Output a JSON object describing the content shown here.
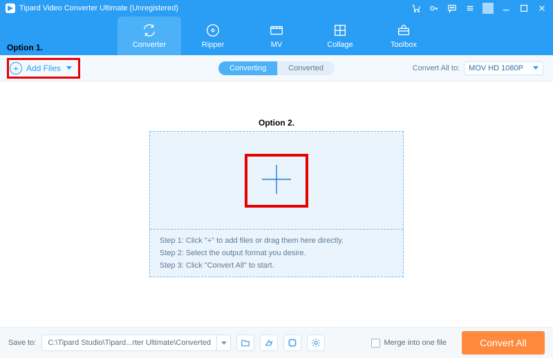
{
  "title": "Tipard Video Converter Ultimate (Unregistered)",
  "tabs": {
    "converter": "Converter",
    "ripper": "Ripper",
    "mv": "MV",
    "collage": "Collage",
    "toolbox": "Toolbox"
  },
  "subbar": {
    "add_files": "Add Files",
    "seg_converting": "Converting",
    "seg_converted": "Converted",
    "convert_all_to": "Convert All to:",
    "format_selected": "MOV HD 1080P"
  },
  "annotations": {
    "option1": "Option 1.",
    "option2": "Option 2."
  },
  "steps": {
    "s1": "Step 1: Click \"+\" to add files or drag them here directly.",
    "s2": "Step 2: Select the output format you desire.",
    "s3": "Step 3: Click \"Convert All\" to start."
  },
  "bottom": {
    "save_to": "Save to:",
    "path": "C:\\Tipard Studio\\Tipard...rter Ultimate\\Converted",
    "merge": "Merge into one file",
    "convert_all": "Convert All"
  }
}
